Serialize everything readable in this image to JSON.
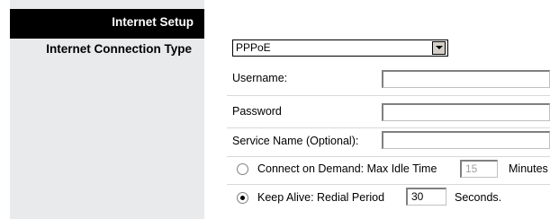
{
  "section": {
    "title": "Internet Setup"
  },
  "connection": {
    "label": "Internet Connection Type",
    "type_selected": "PPPoE"
  },
  "fields": {
    "username_label": "Username:",
    "username_value": "",
    "password_label": "Password",
    "password_value": "",
    "service_name_label": "Service Name (Optional):",
    "service_name_value": ""
  },
  "options": {
    "connect_on_demand": {
      "label": "Connect on Demand: Max Idle Time",
      "value": "15",
      "unit": "Minutes",
      "selected": false
    },
    "keep_alive": {
      "label": "Keep Alive: Redial Period",
      "value": "30",
      "unit": "Seconds.",
      "selected": true
    }
  }
}
